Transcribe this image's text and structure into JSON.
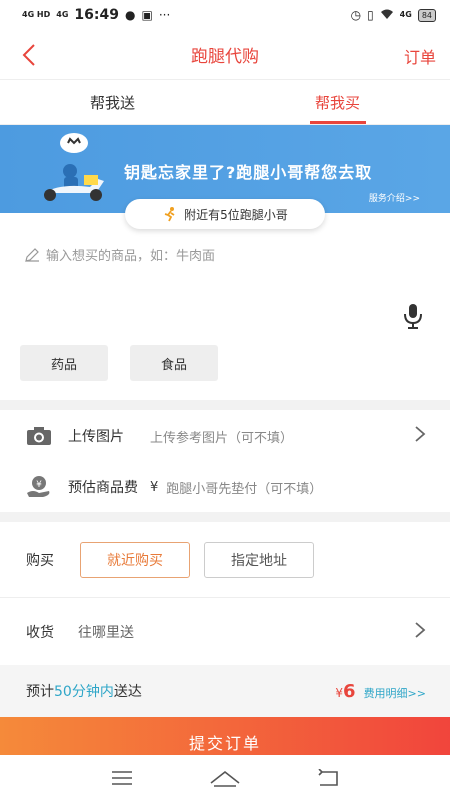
{
  "status_bar": {
    "signal_1": "4G HD",
    "signal_2": "4G",
    "time": "16:49",
    "more": "···",
    "net_label": "4G",
    "battery": "84"
  },
  "nav": {
    "title": "跑腿代购",
    "right_link": "订单"
  },
  "tabs": [
    {
      "label": "帮我送",
      "active": false
    },
    {
      "label": "帮我买",
      "active": true
    }
  ],
  "banner": {
    "headline": "钥匙忘家里了?跑腿小哥帮您去取",
    "link": "服务介绍>>",
    "nearby_text": "附近有5位跑腿小哥"
  },
  "goods": {
    "placeholder": "输入想买的商品，如：牛肉面"
  },
  "quick_chips": [
    {
      "label": "药品"
    },
    {
      "label": "食品"
    }
  ],
  "upload": {
    "label": "上传图片",
    "hint": "上传参考图片（可不填）"
  },
  "fee": {
    "label": "预估商品费",
    "currency": "¥",
    "hint": "跑腿小哥先垫付（可不填）"
  },
  "purchase": {
    "label": "购买",
    "options": [
      {
        "label": "就近购买",
        "active": true
      },
      {
        "label": "指定地址",
        "active": false
      }
    ]
  },
  "receive": {
    "label": "收货",
    "placeholder": "往哪里送"
  },
  "estimate": {
    "prefix": "预计",
    "time": "50分钟内",
    "suffix": "送达",
    "currency": "¥",
    "price": "6",
    "detail_link": "费用明细>>"
  },
  "submit": {
    "label": "提交订单"
  },
  "colors": {
    "accent": "#e8453c",
    "banner_blue": "#5aa6e6",
    "link_blue": "#2fa6c8",
    "option_orange": "#e87b3a"
  }
}
